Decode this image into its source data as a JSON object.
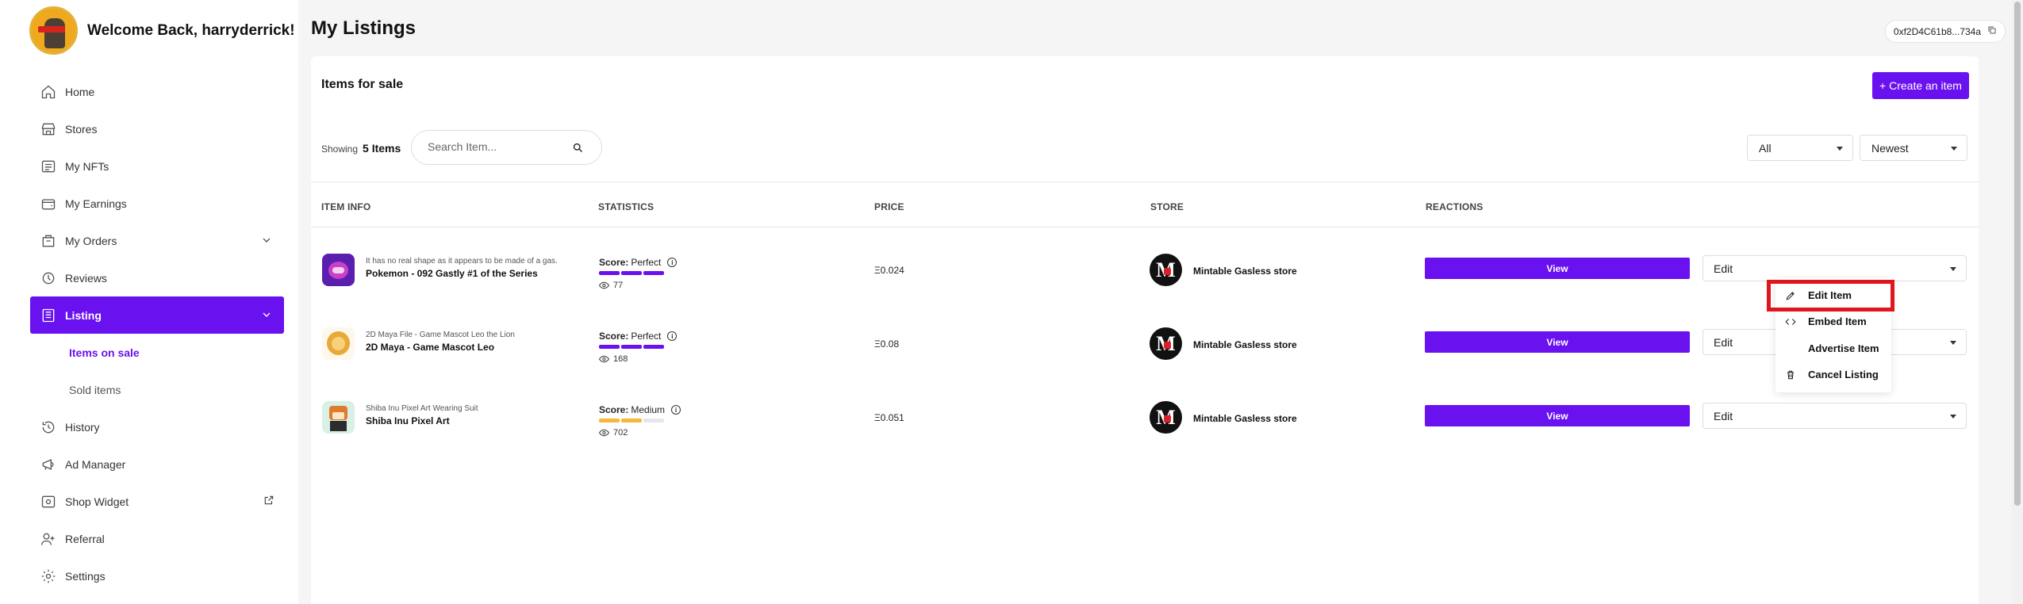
{
  "user": {
    "welcome": "Welcome Back, harryderrick!"
  },
  "sidebar": {
    "items": [
      {
        "label": "Home",
        "icon": "home-icon"
      },
      {
        "label": "Stores",
        "icon": "store-icon"
      },
      {
        "label": "My NFTs",
        "icon": "nft-icon"
      },
      {
        "label": "My Earnings",
        "icon": "wallet-icon"
      },
      {
        "label": "My Orders",
        "icon": "orders-icon"
      },
      {
        "label": "Reviews",
        "icon": "reviews-icon"
      },
      {
        "label": "Listing",
        "icon": "listing-icon"
      },
      {
        "label": "Items on sale"
      },
      {
        "label": "Sold items"
      },
      {
        "label": "History",
        "icon": "history-icon"
      },
      {
        "label": "Ad Manager",
        "icon": "megaphone-icon"
      },
      {
        "label": "Shop Widget",
        "icon": "widget-icon"
      },
      {
        "label": "Referral",
        "icon": "referral-icon"
      },
      {
        "label": "Settings",
        "icon": "gear-icon"
      }
    ]
  },
  "header": {
    "title": "My Listings",
    "wallet": "0xf2D4C61b8...734a"
  },
  "listing": {
    "title": "Items for sale",
    "create_label": "+ Create an item",
    "showing_label": "Showing",
    "count_label": "5 Items",
    "search_placeholder": "Search Item...",
    "filter_value": "All",
    "sort_value": "Newest",
    "columns": [
      "ITEM INFO",
      "STATISTICS",
      "PRICE",
      "STORE",
      "REACTIONS"
    ],
    "rows": [
      {
        "desc": "It has no real shape as it appears to be made of a gas.",
        "name": "Pokemon - 092 Gastly #1 of the Series",
        "score_label": "Score:",
        "score": "Perfect",
        "score_level": 1.0,
        "views": "77",
        "price": "Ξ0.024",
        "store": "Mintable Gasless store",
        "view_label": "View",
        "edit_label": "Edit"
      },
      {
        "desc": "2D Maya File - Game Mascot Leo the Lion",
        "name": "2D Maya - Game Mascot Leo",
        "score_label": "Score:",
        "score": "Perfect",
        "score_level": 1.0,
        "views": "168",
        "price": "Ξ0.08",
        "store": "Mintable Gasless store",
        "view_label": "View",
        "edit_label": "Edit"
      },
      {
        "desc": "Shiba Inu Pixel Art Wearing Suit",
        "name": "Shiba Inu Pixel Art",
        "score_label": "Score:",
        "score": "Medium",
        "score_level": 0.67,
        "views": "702",
        "price": "Ξ0.051",
        "store": "Mintable Gasless store",
        "view_label": "View",
        "edit_label": "Edit"
      }
    ]
  },
  "menu": {
    "items": [
      {
        "label": "Edit Item",
        "icon": "pencil-icon"
      },
      {
        "label": "Embed Item",
        "icon": "code-icon"
      },
      {
        "label": "Advertise Item",
        "icon": ""
      },
      {
        "label": "Cancel Listing",
        "icon": "trash-icon"
      }
    ]
  },
  "colors": {
    "accent": "#6a11f0",
    "highlight": "#e0151d",
    "score_perfect": "#6a11f0",
    "score_medium": "#f5b83a"
  }
}
